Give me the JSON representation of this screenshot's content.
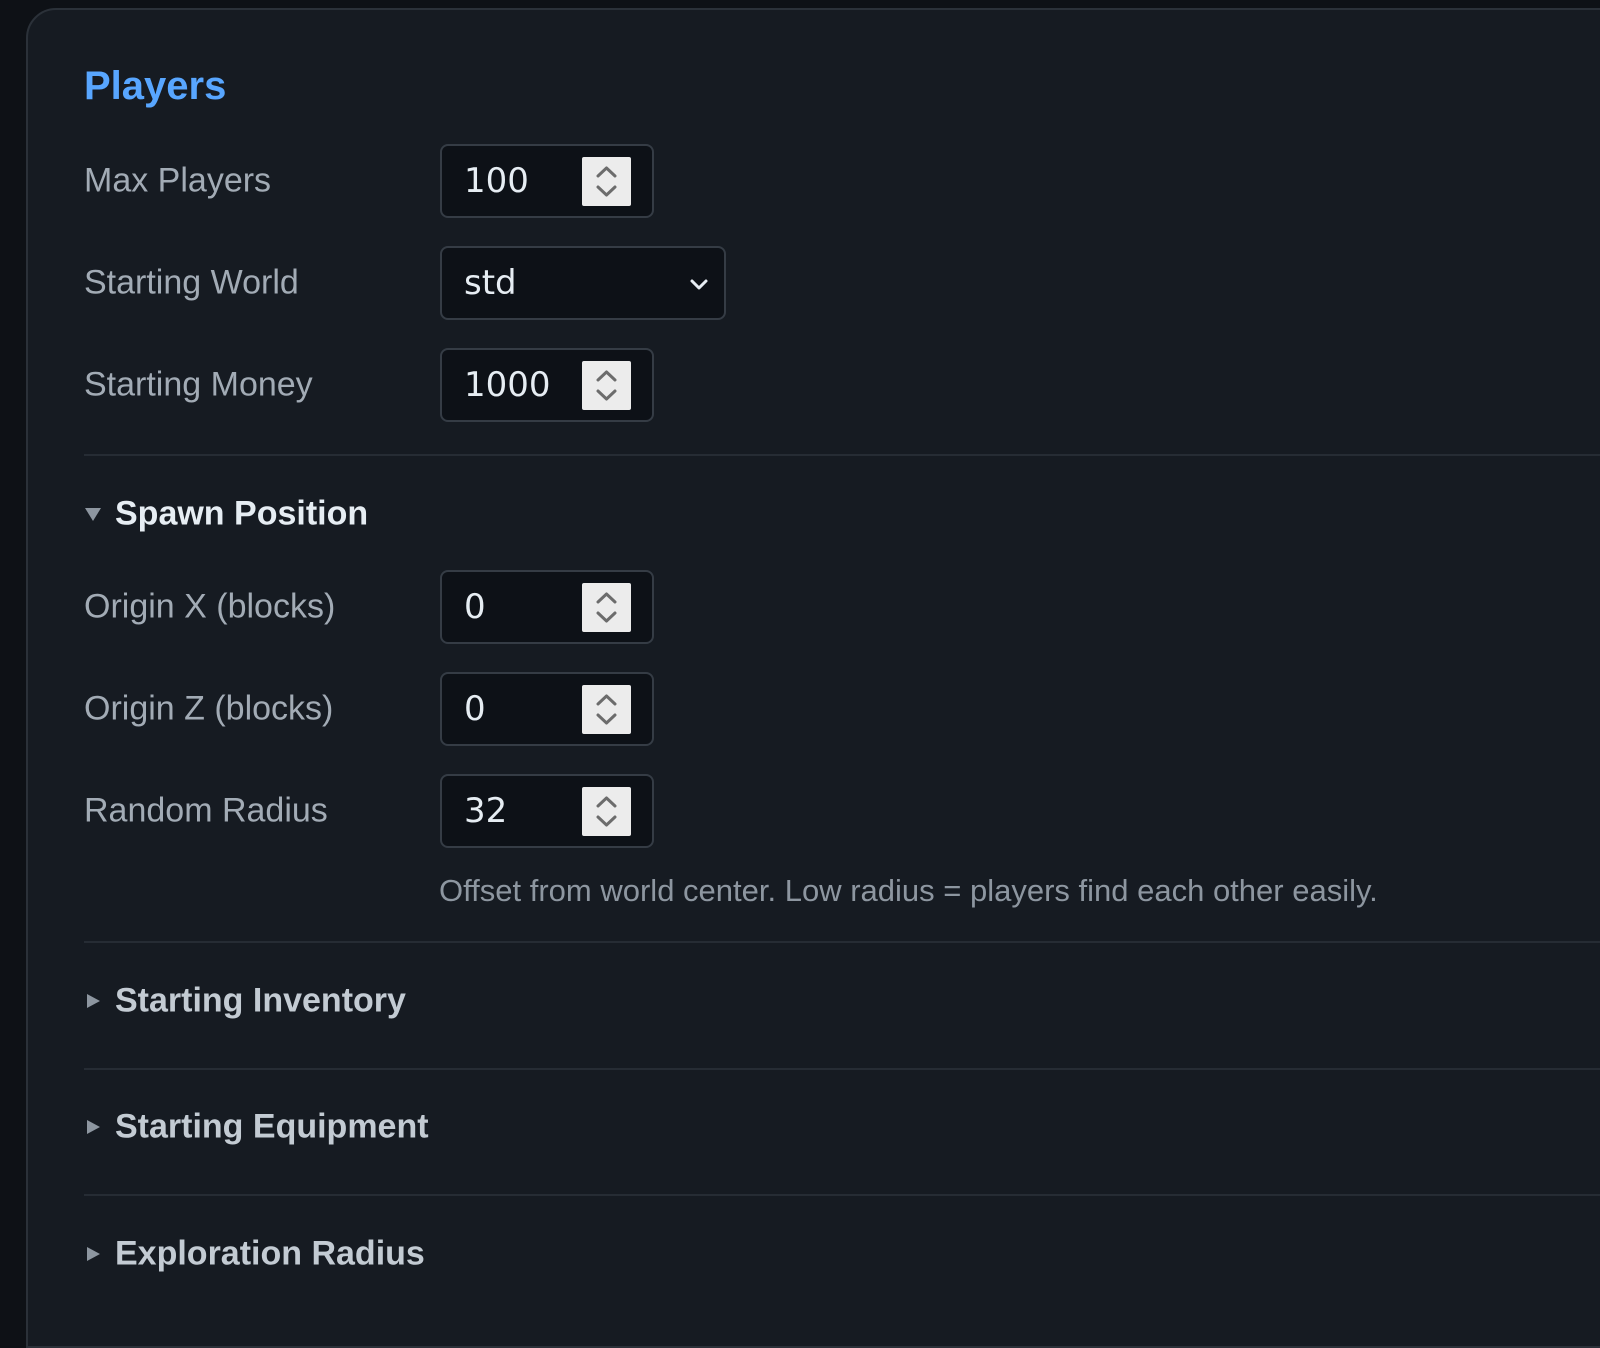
{
  "section": {
    "title": "Players"
  },
  "fields": {
    "max_players": {
      "label": "Max Players",
      "value": "100"
    },
    "starting_world": {
      "label": "Starting World",
      "value": "std"
    },
    "starting_money": {
      "label": "Starting Money",
      "value": "1000"
    }
  },
  "spawn_position": {
    "title": "Spawn Position",
    "expanded": true,
    "origin_x": {
      "label": "Origin X (blocks)",
      "value": "0"
    },
    "origin_z": {
      "label": "Origin Z (blocks)",
      "value": "0"
    },
    "random_radius": {
      "label": "Random Radius",
      "value": "32"
    },
    "hint": "Offset from world center. Low radius = players find each other easily."
  },
  "collapsed_groups": {
    "starting_inventory": {
      "title": "Starting Inventory",
      "expanded": false
    },
    "starting_equipment": {
      "title": "Starting Equipment",
      "expanded": false
    },
    "exploration_radius": {
      "title": "Exploration Radius",
      "expanded": false
    }
  },
  "colors": {
    "accent": "#58a6ff",
    "panel_bg": "#161b22",
    "input_bg": "#0d1117",
    "label": "#a2abb5",
    "text": "#e6edf3"
  },
  "icons": {
    "spinner": "up-down-arrows-icon",
    "select": "chevron-down-icon",
    "expanded": "caret-down-icon",
    "collapsed": "caret-right-icon"
  }
}
